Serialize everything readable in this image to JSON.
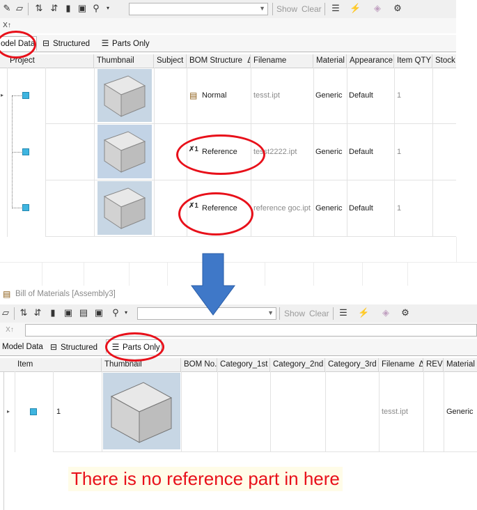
{
  "top": {
    "toolbar": {
      "combo_value": "",
      "show_label": "Show",
      "clear_label": "Clear"
    },
    "tabs": [
      {
        "label": "odel Data"
      },
      {
        "label": "Structured"
      },
      {
        "label": "Parts Only"
      }
    ],
    "columns": [
      "Project",
      "Thumbnail",
      "Subject",
      "BOM Structure",
      "Filename",
      "Material",
      "Appearance",
      "Item QTY",
      "Stock"
    ],
    "sort_indicator": "Δ",
    "rows": [
      {
        "bom_structure": "Normal",
        "filename": "tesst.ipt",
        "material": "Generic",
        "appearance": "Default",
        "item_qty": "1"
      },
      {
        "bom_structure": "Reference",
        "filename": "tesst2222.ipt",
        "material": "Generic",
        "appearance": "Default",
        "item_qty": "1"
      },
      {
        "bom_structure": "Reference",
        "filename": "reference goc.ipt",
        "material": "Generic",
        "appearance": "Default",
        "item_qty": "1"
      }
    ]
  },
  "bottom": {
    "window_title": "Bill of Materials [Assembly3]",
    "toolbar": {
      "combo_value": "",
      "show_label": "Show",
      "clear_label": "Clear"
    },
    "tabs": [
      {
        "label": "Model Data"
      },
      {
        "label": "Structured"
      },
      {
        "label": "Parts Only"
      }
    ],
    "columns": [
      "Item",
      "Thumbnail",
      "BOM No.",
      "Category_1st",
      "Category_2nd",
      "Category_3rd",
      "Filename",
      "REV",
      "Material"
    ],
    "sort_indicator": "Δ",
    "rows": [
      {
        "item": "1",
        "filename": "tesst.ipt",
        "material": "Generic"
      }
    ]
  },
  "annotation": {
    "note": "There is no reference part in here",
    "arrow_color": "#3f78c8",
    "circle_color": "#e8101a"
  },
  "icons": {
    "bom_normal": "bom-structure-icon",
    "bom_reference": "reference-x1-icon",
    "part": "part-cube-icon"
  }
}
